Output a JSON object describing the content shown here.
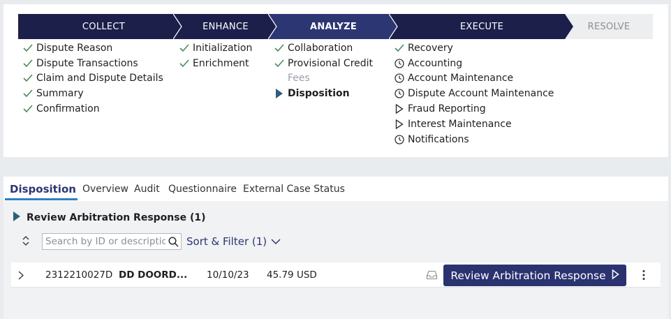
{
  "stages": [
    {
      "label": "COLLECT",
      "state": "done"
    },
    {
      "label": "ENHANCE",
      "state": "done"
    },
    {
      "label": "ANALYZE",
      "state": "current"
    },
    {
      "label": "EXECUTE",
      "state": "done"
    },
    {
      "label": "RESOLVE",
      "state": "future"
    }
  ],
  "steps": {
    "collect": [
      {
        "label": "Dispute Reason",
        "status": "done"
      },
      {
        "label": "Dispute Transactions",
        "status": "done"
      },
      {
        "label": "Claim and Dispute Details",
        "status": "done"
      },
      {
        "label": "Summary",
        "status": "done"
      },
      {
        "label": "Confirmation",
        "status": "done"
      }
    ],
    "enhance": [
      {
        "label": "Initialization",
        "status": "done"
      },
      {
        "label": "Enrichment",
        "status": "done"
      }
    ],
    "analyze": [
      {
        "label": "Collaboration",
        "status": "done"
      },
      {
        "label": "Provisional Credit",
        "status": "done"
      },
      {
        "label": "Fees",
        "status": "skipped"
      },
      {
        "label": "Disposition",
        "status": "current"
      }
    ],
    "execute": [
      {
        "label": "Recovery",
        "status": "done"
      },
      {
        "label": "Accounting",
        "status": "pending"
      },
      {
        "label": "Account Maintenance",
        "status": "pending"
      },
      {
        "label": "Dispute Account Maintenance",
        "status": "pending"
      },
      {
        "label": "Fraud Reporting",
        "status": "upcoming"
      },
      {
        "label": "Interest Maintenance",
        "status": "upcoming"
      },
      {
        "label": "Notifications",
        "status": "pending"
      }
    ]
  },
  "tabs": [
    {
      "label": "Disposition",
      "active": true
    },
    {
      "label": "Overview",
      "active": false
    },
    {
      "label": "Audit",
      "active": false
    },
    {
      "label": "Questionnaire",
      "active": false
    },
    {
      "label": "External Case Status",
      "active": false
    }
  ],
  "group": {
    "title": "Review Arbitration Response (1)"
  },
  "search": {
    "placeholder": "Search by ID or description"
  },
  "sort_filter": {
    "label": "Sort & Filter (1)"
  },
  "row": {
    "id": "2312210027D",
    "merchant": "DD DOORD...",
    "date": "10/10/23",
    "amount": "45.79 USD",
    "action_label": "Review Arbitration Response"
  },
  "colors": {
    "stage_dark": "#1c1f4a",
    "stage_current": "#2c3673",
    "check_green": "#4a8a5c",
    "accent_blue": "#2e7fc4",
    "button": "#2a3270"
  },
  "icons": {
    "done": "check-icon",
    "pending": "clock-icon",
    "upcoming": "play-outline-icon",
    "current": "play-filled-icon"
  }
}
